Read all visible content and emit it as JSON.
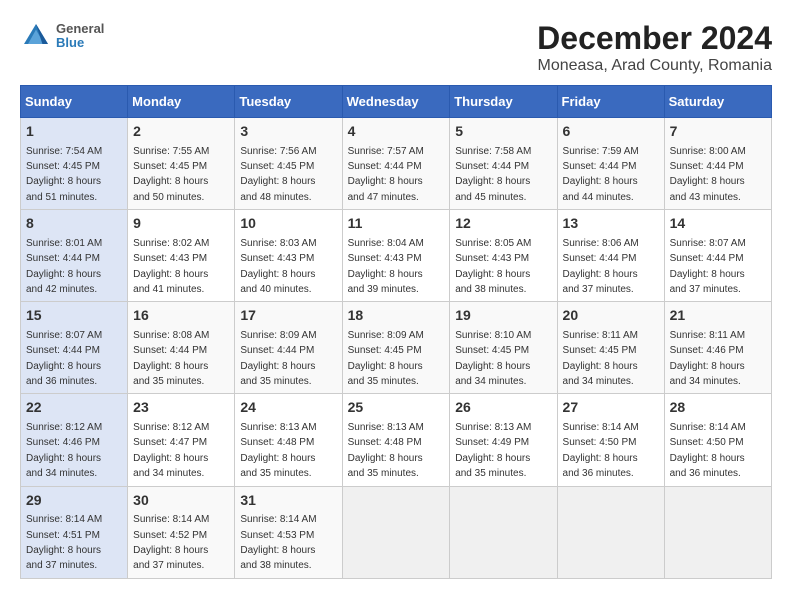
{
  "header": {
    "logo_line1": "General",
    "logo_line2": "Blue",
    "title": "December 2024",
    "subtitle": "Moneasa, Arad County, Romania"
  },
  "columns": [
    "Sunday",
    "Monday",
    "Tuesday",
    "Wednesday",
    "Thursday",
    "Friday",
    "Saturday"
  ],
  "weeks": [
    [
      {
        "day": "1",
        "info": "Sunrise: 7:54 AM\nSunset: 4:45 PM\nDaylight: 8 hours\nand 51 minutes."
      },
      {
        "day": "2",
        "info": "Sunrise: 7:55 AM\nSunset: 4:45 PM\nDaylight: 8 hours\nand 50 minutes."
      },
      {
        "day": "3",
        "info": "Sunrise: 7:56 AM\nSunset: 4:45 PM\nDaylight: 8 hours\nand 48 minutes."
      },
      {
        "day": "4",
        "info": "Sunrise: 7:57 AM\nSunset: 4:44 PM\nDaylight: 8 hours\nand 47 minutes."
      },
      {
        "day": "5",
        "info": "Sunrise: 7:58 AM\nSunset: 4:44 PM\nDaylight: 8 hours\nand 45 minutes."
      },
      {
        "day": "6",
        "info": "Sunrise: 7:59 AM\nSunset: 4:44 PM\nDaylight: 8 hours\nand 44 minutes."
      },
      {
        "day": "7",
        "info": "Sunrise: 8:00 AM\nSunset: 4:44 PM\nDaylight: 8 hours\nand 43 minutes."
      }
    ],
    [
      {
        "day": "8",
        "info": "Sunrise: 8:01 AM\nSunset: 4:44 PM\nDaylight: 8 hours\nand 42 minutes."
      },
      {
        "day": "9",
        "info": "Sunrise: 8:02 AM\nSunset: 4:43 PM\nDaylight: 8 hours\nand 41 minutes."
      },
      {
        "day": "10",
        "info": "Sunrise: 8:03 AM\nSunset: 4:43 PM\nDaylight: 8 hours\nand 40 minutes."
      },
      {
        "day": "11",
        "info": "Sunrise: 8:04 AM\nSunset: 4:43 PM\nDaylight: 8 hours\nand 39 minutes."
      },
      {
        "day": "12",
        "info": "Sunrise: 8:05 AM\nSunset: 4:43 PM\nDaylight: 8 hours\nand 38 minutes."
      },
      {
        "day": "13",
        "info": "Sunrise: 8:06 AM\nSunset: 4:44 PM\nDaylight: 8 hours\nand 37 minutes."
      },
      {
        "day": "14",
        "info": "Sunrise: 8:07 AM\nSunset: 4:44 PM\nDaylight: 8 hours\nand 37 minutes."
      }
    ],
    [
      {
        "day": "15",
        "info": "Sunrise: 8:07 AM\nSunset: 4:44 PM\nDaylight: 8 hours\nand 36 minutes."
      },
      {
        "day": "16",
        "info": "Sunrise: 8:08 AM\nSunset: 4:44 PM\nDaylight: 8 hours\nand 35 minutes."
      },
      {
        "day": "17",
        "info": "Sunrise: 8:09 AM\nSunset: 4:44 PM\nDaylight: 8 hours\nand 35 minutes."
      },
      {
        "day": "18",
        "info": "Sunrise: 8:09 AM\nSunset: 4:45 PM\nDaylight: 8 hours\nand 35 minutes."
      },
      {
        "day": "19",
        "info": "Sunrise: 8:10 AM\nSunset: 4:45 PM\nDaylight: 8 hours\nand 34 minutes."
      },
      {
        "day": "20",
        "info": "Sunrise: 8:11 AM\nSunset: 4:45 PM\nDaylight: 8 hours\nand 34 minutes."
      },
      {
        "day": "21",
        "info": "Sunrise: 8:11 AM\nSunset: 4:46 PM\nDaylight: 8 hours\nand 34 minutes."
      }
    ],
    [
      {
        "day": "22",
        "info": "Sunrise: 8:12 AM\nSunset: 4:46 PM\nDaylight: 8 hours\nand 34 minutes."
      },
      {
        "day": "23",
        "info": "Sunrise: 8:12 AM\nSunset: 4:47 PM\nDaylight: 8 hours\nand 34 minutes."
      },
      {
        "day": "24",
        "info": "Sunrise: 8:13 AM\nSunset: 4:48 PM\nDaylight: 8 hours\nand 35 minutes."
      },
      {
        "day": "25",
        "info": "Sunrise: 8:13 AM\nSunset: 4:48 PM\nDaylight: 8 hours\nand 35 minutes."
      },
      {
        "day": "26",
        "info": "Sunrise: 8:13 AM\nSunset: 4:49 PM\nDaylight: 8 hours\nand 35 minutes."
      },
      {
        "day": "27",
        "info": "Sunrise: 8:14 AM\nSunset: 4:50 PM\nDaylight: 8 hours\nand 36 minutes."
      },
      {
        "day": "28",
        "info": "Sunrise: 8:14 AM\nSunset: 4:50 PM\nDaylight: 8 hours\nand 36 minutes."
      }
    ],
    [
      {
        "day": "29",
        "info": "Sunrise: 8:14 AM\nSunset: 4:51 PM\nDaylight: 8 hours\nand 37 minutes."
      },
      {
        "day": "30",
        "info": "Sunrise: 8:14 AM\nSunset: 4:52 PM\nDaylight: 8 hours\nand 37 minutes."
      },
      {
        "day": "31",
        "info": "Sunrise: 8:14 AM\nSunset: 4:53 PM\nDaylight: 8 hours\nand 38 minutes."
      },
      null,
      null,
      null,
      null
    ]
  ]
}
